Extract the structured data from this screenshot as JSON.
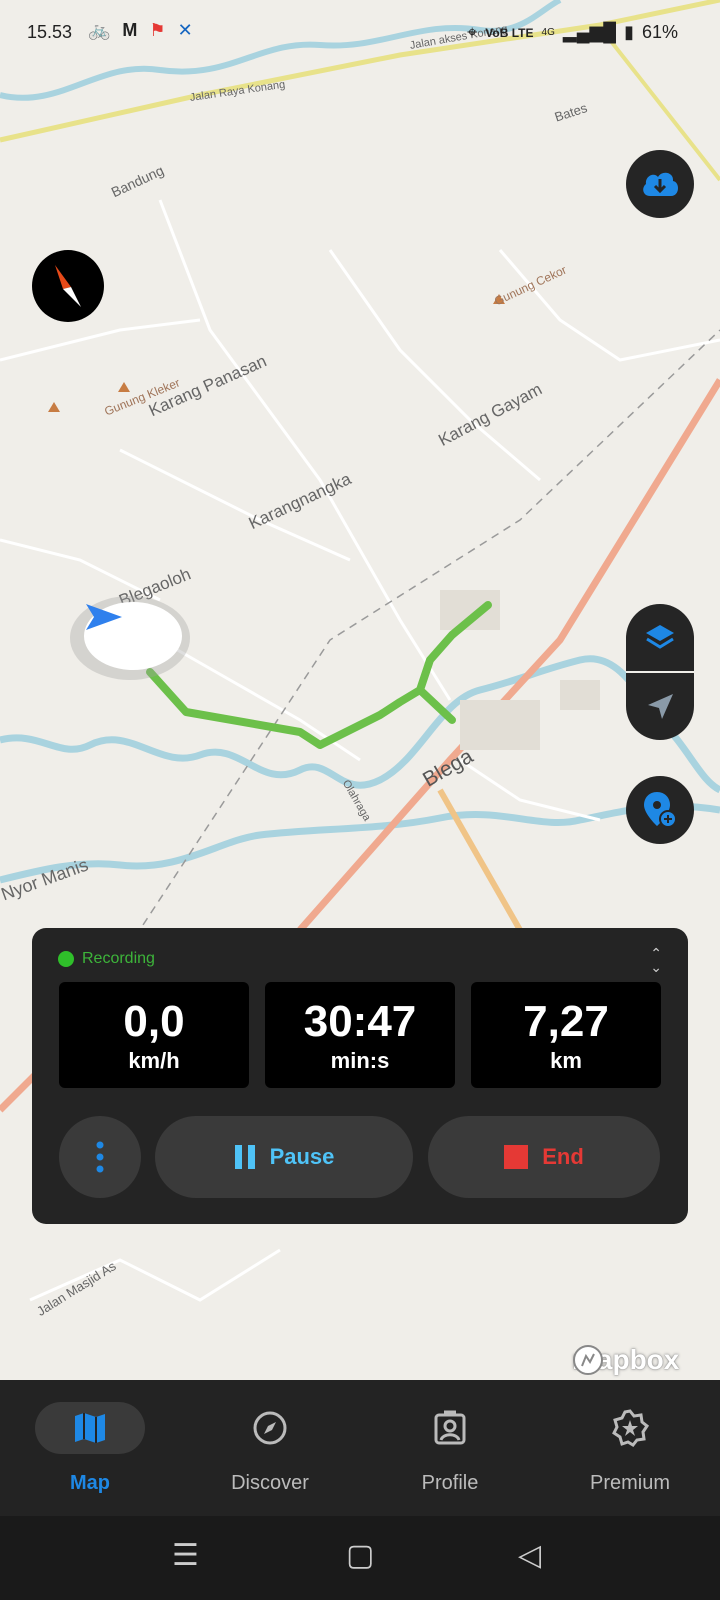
{
  "status_bar": {
    "time": "15.53",
    "network": "VoB LTE",
    "signal": "4G",
    "battery": "61%"
  },
  "map": {
    "labels": {
      "jalan_raya_konang": "Jalan Raya Konang",
      "jalan_akses_konang": "Jalan akses Konang",
      "bates": "Bates",
      "bandung": "Bandung",
      "gunung_cekor": "Gunung Cekor",
      "gunung_kleker": "Gunung Kleker",
      "karang_panasan": "Karang Panasan",
      "karang_gayam": "Karang Gayam",
      "karangnangka": "Karangnangka",
      "blegaoloh": "Blegaoloh",
      "blega": "Blega",
      "olahraga": "Olahraga",
      "nyor_manis": "Nyor Manis",
      "jalan_masjid": "Jalan Masjid As"
    },
    "attribution": "mapbox"
  },
  "controls": {
    "download_icon": "cloud-download-icon",
    "compass_icon": "compass-icon",
    "layers_icon": "layers-icon",
    "locate_icon": "navigation-arrow-icon",
    "add_poi_icon": "add-location-icon"
  },
  "recording": {
    "status": "Recording",
    "speed": {
      "value": "0,0",
      "unit": "km/h"
    },
    "duration": {
      "value": "30:47",
      "unit": "min:s"
    },
    "distance": {
      "value": "7,27",
      "unit": "km"
    },
    "pause_label": "Pause",
    "end_label": "End"
  },
  "colors": {
    "accent": "#1e88e5",
    "track": "#6cc04a",
    "recording": "#2fbf2a",
    "end": "#e53935",
    "pause": "#4fc3f7"
  },
  "bottom_nav": {
    "items": [
      {
        "label": "Map",
        "icon": "map-icon",
        "active": true
      },
      {
        "label": "Discover",
        "icon": "compass-icon",
        "active": false
      },
      {
        "label": "Profile",
        "icon": "profile-icon",
        "active": false
      },
      {
        "label": "Premium",
        "icon": "badge-star-icon",
        "active": false
      }
    ]
  }
}
